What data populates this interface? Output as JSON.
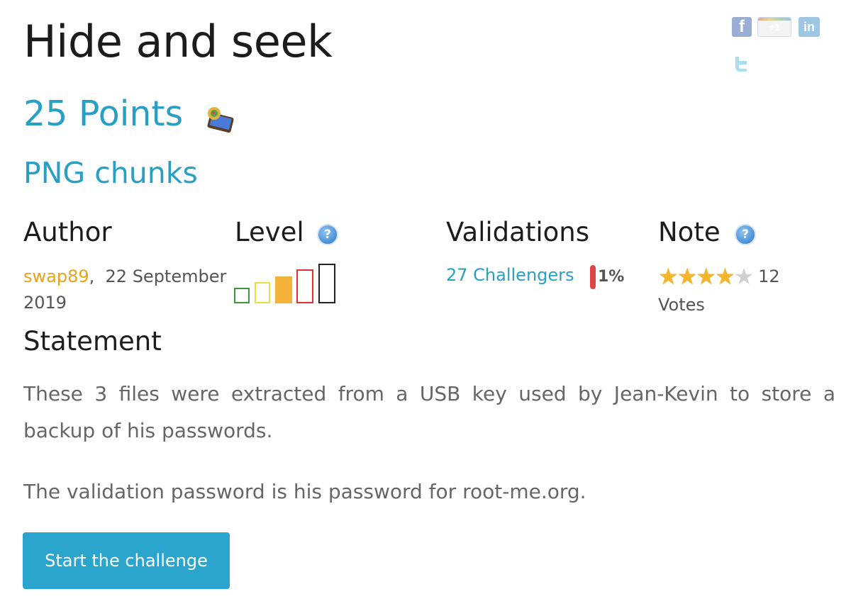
{
  "challenge": {
    "title": "Hide and seek",
    "points": "25 Points",
    "subtitle": "PNG chunks"
  },
  "social": {
    "facebook_icon": "facebook-icon",
    "gplus_label": "+1",
    "linkedin_label": "in",
    "twitter_icon": "twitter-icon"
  },
  "columns": {
    "author": "Author",
    "level": "Level",
    "validations": "Validations",
    "note": "Note"
  },
  "author": {
    "name": "swap89",
    "separator": ",",
    "date": "22 September 2019"
  },
  "level": {
    "current": 3,
    "max": 5,
    "colors": [
      "#3a9a3a",
      "#e8e040",
      "#f3b23a",
      "#e03030",
      "#222222"
    ],
    "help_icon": "help-icon"
  },
  "validations": {
    "challengers": "27 Challengers",
    "percent": "1%",
    "bar_color": "#e04545"
  },
  "note": {
    "rating": 4,
    "max": 5,
    "votes": "12 Votes",
    "help_icon": "help-icon"
  },
  "statement": {
    "heading": "Statement",
    "paragraphs": [
      "These 3 files were extracted from a USB key used by Jean-Kevin to store a backup of his passwords.",
      "The validation password is his password for root-me.org."
    ]
  },
  "actions": {
    "start_label": "Start the challenge"
  },
  "colors": {
    "accent": "#2a9fc5",
    "author_link": "#e9a316",
    "button": "#2ba4ce"
  }
}
